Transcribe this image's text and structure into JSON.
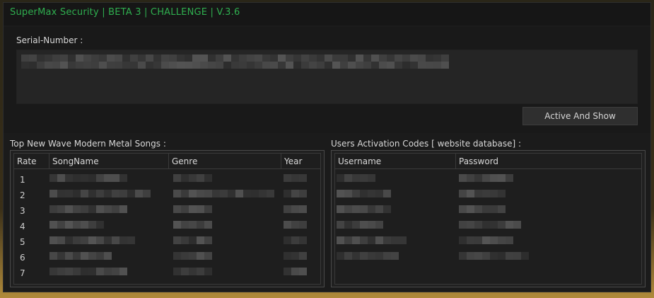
{
  "window": {
    "title": "SuperMax Security | BETA 3 | CHALLENGE | V.3.6",
    "title_color": "#2fae4f"
  },
  "serial": {
    "label": "Serial-Number :",
    "value": ""
  },
  "action_button": {
    "label": "Active And Show"
  },
  "songs_table": {
    "label": "Top New Wave Modern Metal Songs :",
    "columns": [
      "Rate",
      "SongName",
      "Genre",
      "Year"
    ],
    "rows": [
      {
        "rate": "1"
      },
      {
        "rate": "2"
      },
      {
        "rate": "3"
      },
      {
        "rate": "4"
      },
      {
        "rate": "5"
      },
      {
        "rate": "6"
      },
      {
        "rate": "7"
      }
    ]
  },
  "users_table": {
    "label": "Users Activation Codes [ website database]  :",
    "columns": [
      "Username",
      "Password"
    ]
  }
}
